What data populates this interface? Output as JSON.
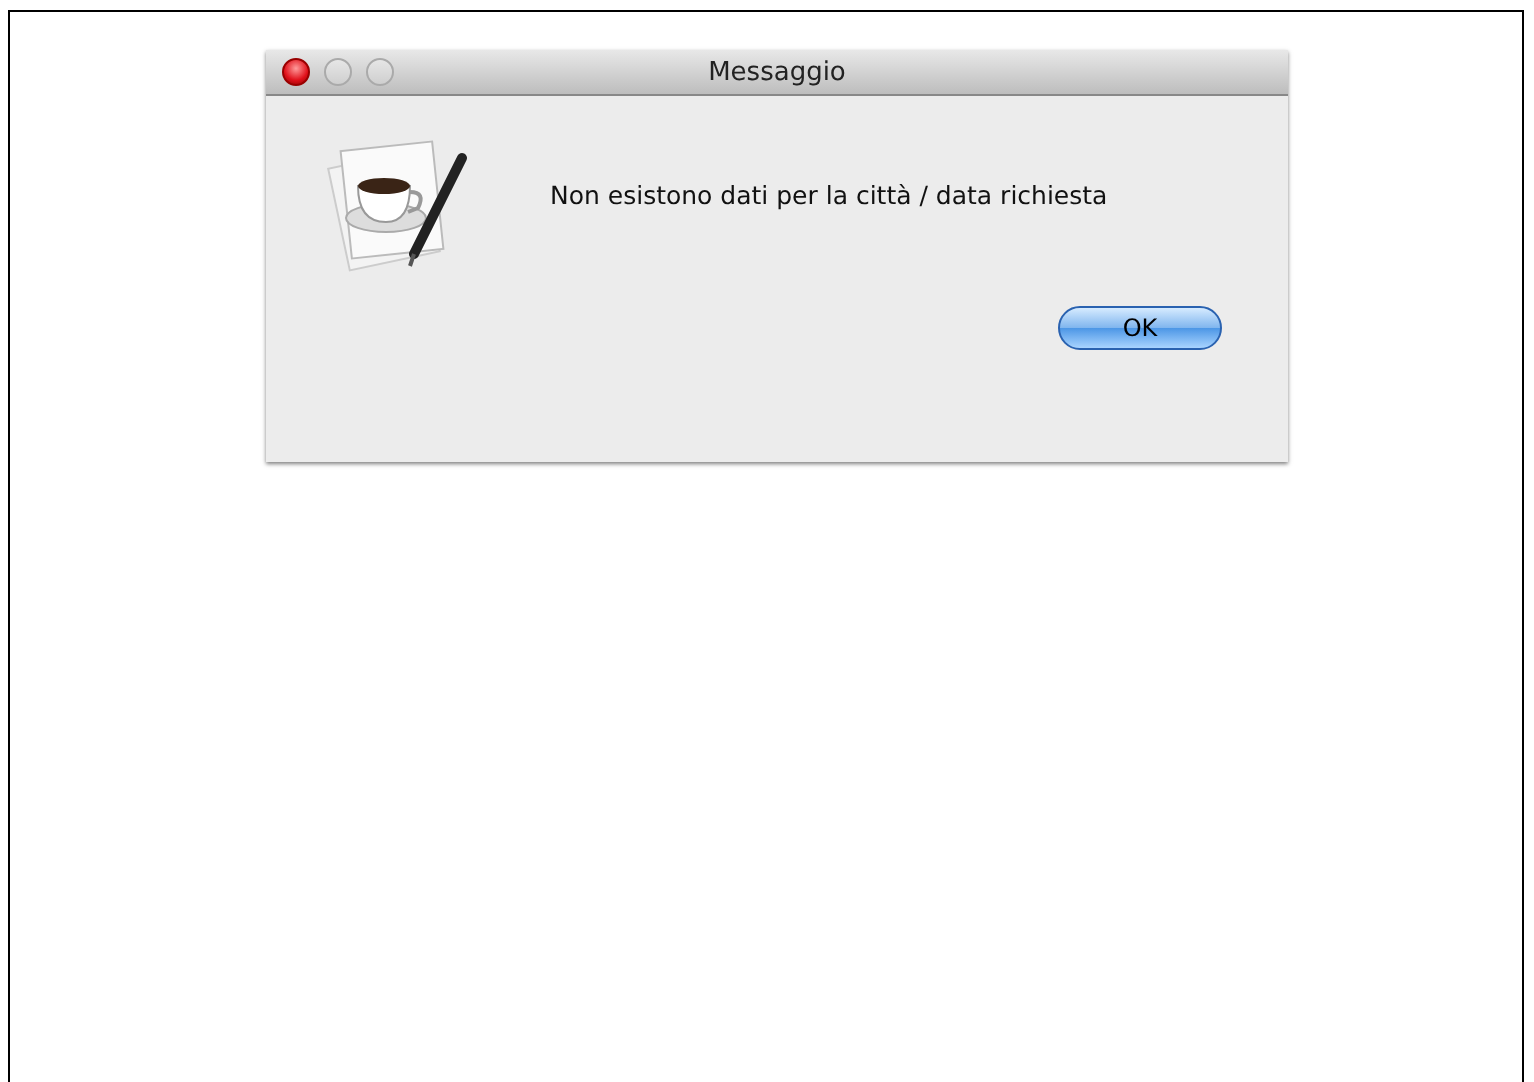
{
  "dialog": {
    "title": "Messaggio",
    "message": "Non esistono dati per la città / data richiesta",
    "buttons": [
      {
        "label": "OK",
        "default": true
      }
    ]
  }
}
